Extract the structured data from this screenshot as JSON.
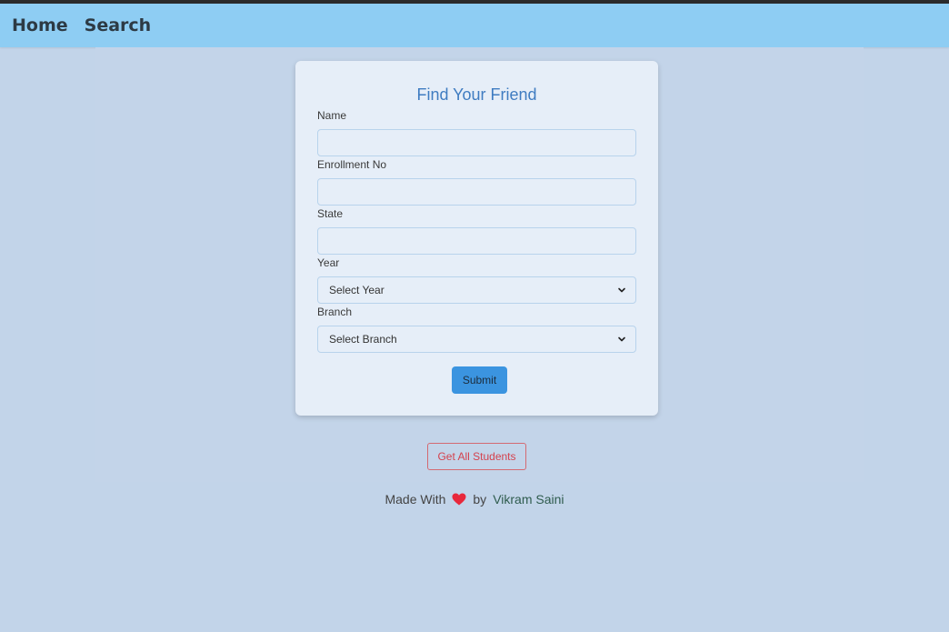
{
  "nav": {
    "home": "Home",
    "search": "Search"
  },
  "form": {
    "title": "Find Your Friend",
    "name_label": "Name",
    "name_value": "",
    "enrollment_label": "Enrollment No",
    "enrollment_value": "",
    "state_label": "State",
    "state_value": "",
    "year_label": "Year",
    "year_selected": "Select Year",
    "branch_label": "Branch",
    "branch_selected": "Select Branch",
    "submit_label": "Submit"
  },
  "get_all_label": "Get All Students",
  "footer": {
    "made_with": "Made With",
    "by": "by",
    "author": "Vikram Saini",
    "icon": "heart-icon"
  },
  "colors": {
    "navbar": "#8ecdf3",
    "background": "#c2d4e9",
    "card": "#e6eef8",
    "title": "#3f7cc1",
    "submit": "#3b94e0",
    "get_all_border": "#d46a72",
    "heart": "#e8283c"
  }
}
